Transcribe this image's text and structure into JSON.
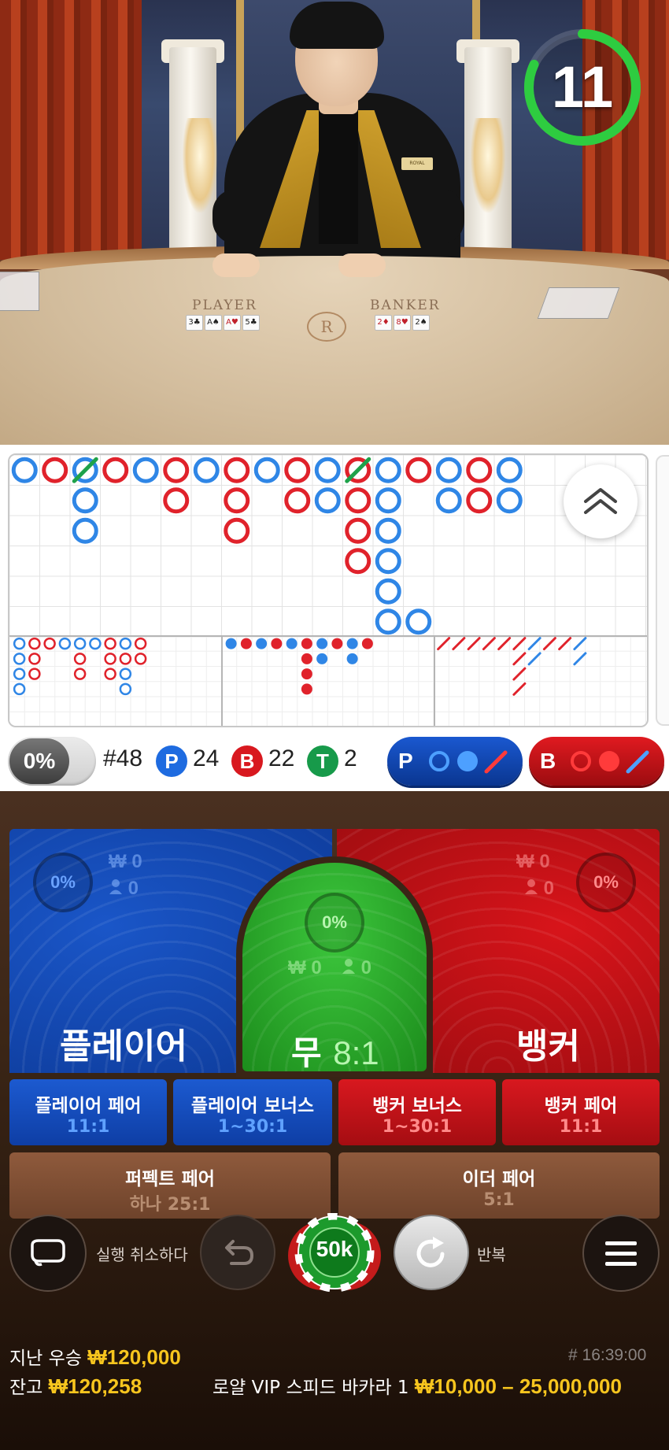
{
  "video": {
    "table_left_label": "PLAYER",
    "table_right_label": "BANKER",
    "table_logo": "R",
    "badge_text": "ROYAL",
    "player_cards": [
      "3♣",
      "A♠",
      "A♥",
      "5♣"
    ],
    "banker_cards": [
      "2♦",
      "8♥",
      "2♠"
    ]
  },
  "timer": {
    "value": "11",
    "remaining_fraction": 0.82,
    "color": "#2ecc40"
  },
  "stats": {
    "percent": "0%",
    "shoe_count": "#48",
    "player_letter": "P",
    "player_count": "24",
    "banker_letter": "B",
    "banker_count": "22",
    "tie_letter": "T",
    "tie_count": "2",
    "colors": {
      "player": "#1e6be0",
      "banker": "#d8181f",
      "tie": "#179a4a"
    }
  },
  "predict": {
    "player": {
      "letter": "P",
      "icons": [
        "hollow-circle-icon",
        "filled-circle-icon",
        "slash-icon"
      ]
    },
    "banker": {
      "letter": "B",
      "icons": [
        "hollow-circle-icon",
        "filled-circle-icon",
        "slash-icon"
      ]
    }
  },
  "bigroad": [
    [
      "P"
    ],
    [
      "B"
    ],
    [
      "P",
      "P",
      "P"
    ],
    [
      "B"
    ],
    [
      "P"
    ],
    [
      "B",
      "B"
    ],
    [
      "P"
    ],
    [
      "B",
      "B",
      "B"
    ],
    [
      "P"
    ],
    [
      "B",
      "B"
    ],
    [
      "P",
      "P"
    ],
    [
      "B",
      "B",
      "B",
      "B"
    ],
    [
      "P",
      "P",
      "P",
      "P",
      "P",
      "P"
    ],
    [
      "B"
    ],
    [
      "P",
      "P"
    ],
    [
      "B",
      "B"
    ],
    [
      "P",
      "P"
    ]
  ],
  "bigroad_extra": [
    {
      "col": 13,
      "row": 5,
      "v": "P"
    }
  ],
  "bigroad_ties": [
    {
      "col": 2,
      "row": 0
    },
    {
      "col": 11,
      "row": 0
    }
  ],
  "bigeye": [
    [
      "P",
      "P",
      "P",
      "P"
    ],
    [
      "B",
      "B",
      "B"
    ],
    [
      "B"
    ],
    [
      "P"
    ],
    [
      "P",
      "B",
      "B"
    ],
    [
      "P"
    ],
    [
      "B",
      "B",
      "B"
    ],
    [
      "P",
      "B",
      "P",
      "P"
    ],
    [
      "B",
      "B"
    ]
  ],
  "smallroad": [
    [
      "P"
    ],
    [
      "B"
    ],
    [
      "P"
    ],
    [
      "B"
    ],
    [
      "P"
    ],
    [
      "B",
      "B",
      "B",
      "B"
    ],
    [
      "P",
      "P"
    ],
    [
      "B"
    ],
    [
      "P",
      "P"
    ],
    [
      "B"
    ]
  ],
  "cockroach": [
    [
      "B"
    ],
    [
      "B"
    ],
    [
      "B"
    ],
    [
      "B"
    ],
    [
      "B"
    ],
    [
      "B",
      "B",
      "B",
      "B"
    ],
    [
      "P",
      "P"
    ],
    [
      "B"
    ],
    [
      "B"
    ],
    [
      "P",
      "P"
    ]
  ],
  "bets": {
    "player": {
      "percent": "0%",
      "amount": "₩ 0",
      "players": "0",
      "label": "플레이어"
    },
    "tie": {
      "percent": "0%",
      "amount": "₩ 0",
      "players": "0",
      "label": "무",
      "odds": "8:1"
    },
    "banker": {
      "percent": "0%",
      "amount": "₩ 0",
      "players": "0",
      "label": "뱅커"
    }
  },
  "side_bets": [
    {
      "title": "플레이어 페어",
      "odds": "11:1"
    },
    {
      "title": "플레이어 보너스",
      "odds": "1~30:1"
    },
    {
      "title": "뱅커 보너스",
      "odds": "1~30:1"
    },
    {
      "title": "뱅커 페어",
      "odds": "11:1"
    },
    {
      "title": "퍼펙트 페어",
      "odds": "하나 25:1"
    },
    {
      "title": "이더 페어",
      "odds": "5:1"
    }
  ],
  "controls": {
    "undo_label": "실행 취소하다",
    "chip_value": "50k",
    "repeat_label": "반복"
  },
  "footer": {
    "last_win_label": "지난 우승",
    "last_win_value": "₩120,000",
    "balance_label": "잔고",
    "balance_value": "₩120,258",
    "round_id": "# 16:39:00",
    "table_name": "로얄 VIP 스피드 바카라 1",
    "limits": "₩10,000 – 25,000,000"
  }
}
